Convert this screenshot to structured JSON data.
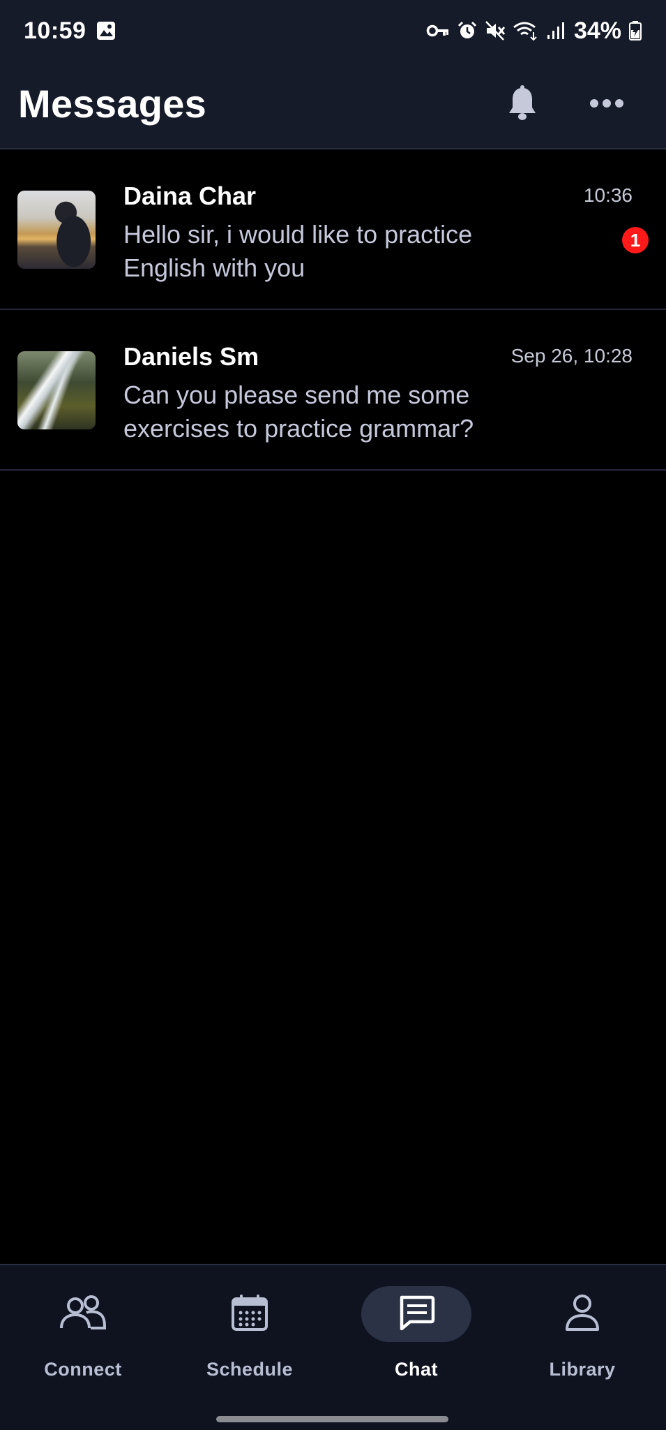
{
  "status_bar": {
    "time": "10:59",
    "battery": "34%",
    "icons": [
      "gallery-icon",
      "key-icon",
      "alarm-icon",
      "mute-icon",
      "wifi-icon",
      "signal-icon",
      "battery-icon"
    ]
  },
  "header": {
    "title": "Messages",
    "icons": [
      "bell-icon",
      "more-icon"
    ]
  },
  "conversations": [
    {
      "name": "Daina Char",
      "time": "10:36",
      "preview": "Hello sir, i would like to practice English with you",
      "unread": "1"
    },
    {
      "name": "Daniels Sm",
      "time": "Sep 26, 10:28",
      "preview": "Can you please send me some exercises to practice grammar?"
    }
  ],
  "nav": {
    "items": [
      {
        "label": "Connect",
        "icon": "people-icon",
        "active": false
      },
      {
        "label": "Schedule",
        "icon": "calendar-icon",
        "active": false
      },
      {
        "label": "Chat",
        "icon": "chat-icon",
        "active": true
      },
      {
        "label": "Library",
        "icon": "person-icon",
        "active": false
      }
    ]
  },
  "colors": {
    "background": "#000000",
    "header": "#161b2a",
    "nav_background": "#0f1320",
    "active_pill": "#2b3246",
    "badge": "#ff1a1a",
    "secondary_text": "#c6c9dc"
  }
}
